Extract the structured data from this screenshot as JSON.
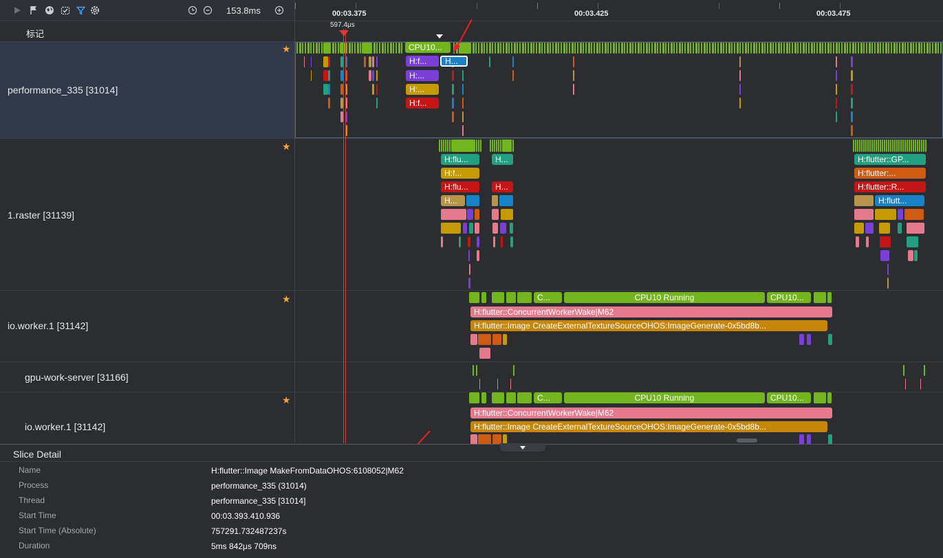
{
  "toolbar": {
    "icons": [
      "play-icon",
      "flag-icon",
      "globe-icon",
      "calendar-check-icon",
      "filter-icon",
      "settings-icon",
      "reset-zoom-icon",
      "zoom-out-icon",
      "zoom-in-icon"
    ],
    "time_range": "153.8ms"
  },
  "timescale": {
    "ticks": [
      "00:03.375",
      "00:03.425",
      "00:03.475"
    ]
  },
  "marker_row": {
    "label": "标记",
    "delta": "597.4μs"
  },
  "tracks": [
    {
      "name": "performance_335 [31014]",
      "slices": [
        "CPU10...",
        "H:f...",
        "H...",
        "H:...",
        "H:...",
        "H:f..."
      ]
    },
    {
      "name": "1.raster [31139]",
      "slices": [
        "H:flu...",
        "H...",
        "H:f...",
        "H:flu...",
        "H...",
        "H...",
        "H:flutter::GP...",
        "H:flutter:...",
        "H:flutter::R...",
        "H:flutt..."
      ]
    },
    {
      "name": "io.worker.1 [31142]",
      "slices": [
        "C...",
        "CPU10 Running",
        "CPU10...",
        "H:flutter::ConcurrentWorkerWake|M62",
        "H:flutter::Image CreateExternalTextureSourceOHOS:ImageGenerate-0x5bd8b..."
      ]
    },
    {
      "name": "gpu-work-server [31166]"
    },
    {
      "name": "io.worker.1 [31142]",
      "slices": [
        "C...",
        "CPU10 Running",
        "CPU10...",
        "H:flutter::ConcurrentWorkerWake|M62",
        "H:flutter::Image CreateExternalTextureSourceOHOS:ImageGenerate-0x5bd8b..."
      ]
    }
  ],
  "details": {
    "title": "Slice Detail",
    "rows": [
      {
        "key": "Name",
        "value": "H:flutter::Image MakeFromDataOHOS:6108052|M62"
      },
      {
        "key": "Process",
        "value": "performance_335 (31014)"
      },
      {
        "key": "Thread",
        "value": "performance_335 [31014]"
      },
      {
        "key": "Start Time",
        "value": "00:03.393.410.936"
      },
      {
        "key": "Start Time (Absolute)",
        "value": "757291.732487237s"
      },
      {
        "key": "Duration",
        "value": "5ms 842μs 709ns"
      }
    ]
  },
  "colors": {
    "cpu_green": "#72b51f",
    "teal": "#22a07f",
    "gold": "#c59a05",
    "red": "#c41616",
    "purple": "#7a3fd6",
    "blue": "#1a83c7",
    "pink": "#e57a8e",
    "orange": "#cf5a12",
    "tan": "#b79447",
    "accent_red": "#d93a3a"
  }
}
